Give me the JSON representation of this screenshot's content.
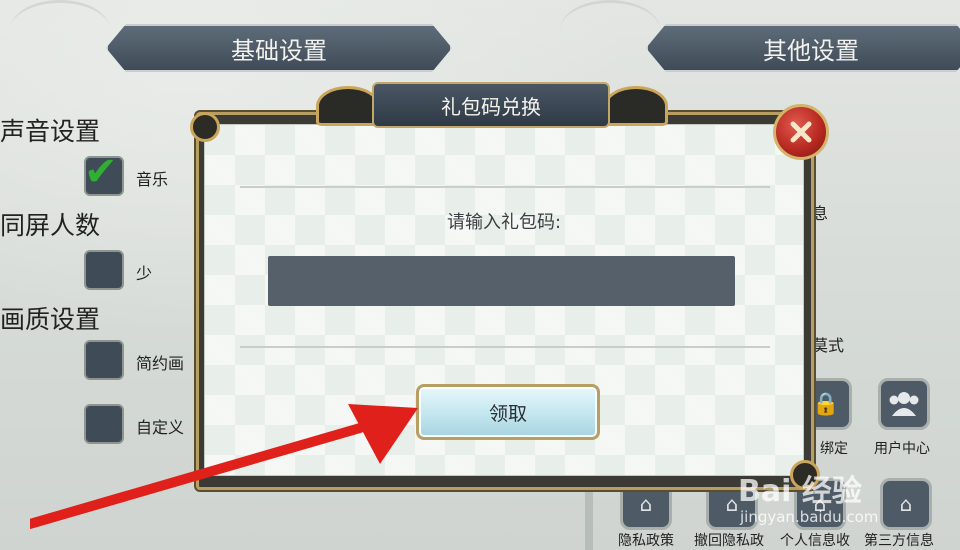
{
  "tabs": {
    "basic": "基础设置",
    "other": "其他设置"
  },
  "sections": {
    "sound": {
      "title": "声音设置",
      "option": "音乐"
    },
    "crowd": {
      "title": "同屏人数",
      "option": "少"
    },
    "quality": {
      "title": "画质设置",
      "option1": "简约画",
      "option2": "自定义"
    }
  },
  "side_texts": {
    "info": "息",
    "mode": "莫式",
    "bind": "绑定"
  },
  "icons": [
    {
      "label": "用户中心",
      "icon": "users-icon"
    },
    {
      "label": "隐私政策",
      "icon": "home-icon"
    },
    {
      "label": "撤回隐私政",
      "icon": "home-icon"
    },
    {
      "label": "个人信息收",
      "icon": "home-icon"
    },
    {
      "label": "第三方信息",
      "icon": "home-icon"
    }
  ],
  "modal": {
    "title": "礼包码兑换",
    "prompt": "请输入礼包码:",
    "input_value": "",
    "input_placeholder": "",
    "claim_label": "领取",
    "close_icon": "close-icon"
  },
  "watermark": {
    "brand": "Bai 经验",
    "url": "jingyan.baidu.com"
  },
  "colors": {
    "accent_gold": "#b79e63",
    "close_red": "#b82a22",
    "annotation_red": "#e0211b",
    "check_green": "#2fb033"
  }
}
